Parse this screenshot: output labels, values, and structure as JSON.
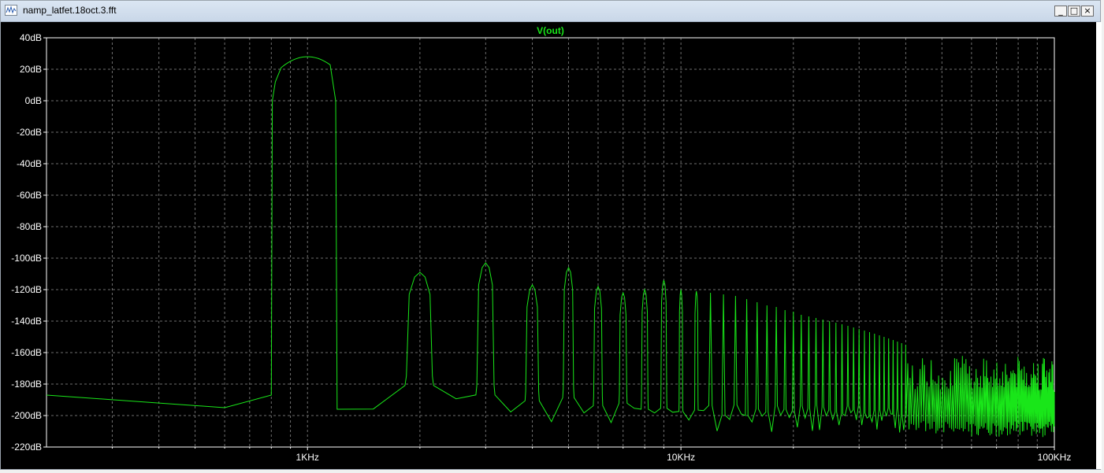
{
  "window": {
    "title": "namp_latfet.18oct.3.fft",
    "buttons": {
      "minimize": "_",
      "maximize": "□",
      "close": "×"
    }
  },
  "colors": {
    "trace": "#19e619",
    "title": "#19e619",
    "background": "#000000",
    "grid": "#6e6e6e",
    "axis_text": "#ffffff"
  },
  "chart_data": {
    "type": "line",
    "title": "V(out)",
    "xscale": "log",
    "xlim": [
      200,
      100000
    ],
    "ylim": [
      -220,
      40
    ],
    "xticks": [
      1000,
      10000,
      100000
    ],
    "xtick_labels": [
      "1KHz",
      "10KHz",
      "100KHz"
    ],
    "yticks": [
      40,
      20,
      0,
      -20,
      -40,
      -60,
      -80,
      -100,
      -120,
      -140,
      -160,
      -180,
      -200,
      -220
    ],
    "ytick_labels": [
      "40dB",
      "20dB",
      "0dB",
      "-20dB",
      "-40dB",
      "-60dB",
      "-80dB",
      "-100dB",
      "-120dB",
      "-140dB",
      "-160dB",
      "-180dB",
      "-200dB",
      "-220dB"
    ],
    "grid": true,
    "harmonics": {
      "fundamental_hz": 1000,
      "fundamental_db": 28,
      "peaks_db": [
        28,
        -109,
        -103,
        -117,
        -106,
        -118,
        -122,
        -120,
        -114,
        -120,
        -121,
        -122,
        -123,
        -124,
        -126,
        -128,
        -130,
        -131,
        -133,
        -134,
        -136,
        -137,
        -138,
        -139,
        -140,
        -141,
        -142,
        -143,
        -144,
        -145,
        -146,
        -147,
        -148,
        -149,
        -150,
        -151,
        -152,
        -153,
        -154,
        -155
      ]
    },
    "noise_floor_db": [
      [
        200,
        -187
      ],
      [
        600,
        -195
      ],
      [
        800,
        -187
      ],
      [
        1200,
        -196
      ],
      [
        1500,
        -188
      ],
      [
        2000,
        -181
      ],
      [
        3000,
        -190
      ],
      [
        5000,
        -192
      ],
      [
        10000,
        -196
      ],
      [
        30000,
        -197
      ],
      [
        100000,
        -198
      ]
    ]
  }
}
